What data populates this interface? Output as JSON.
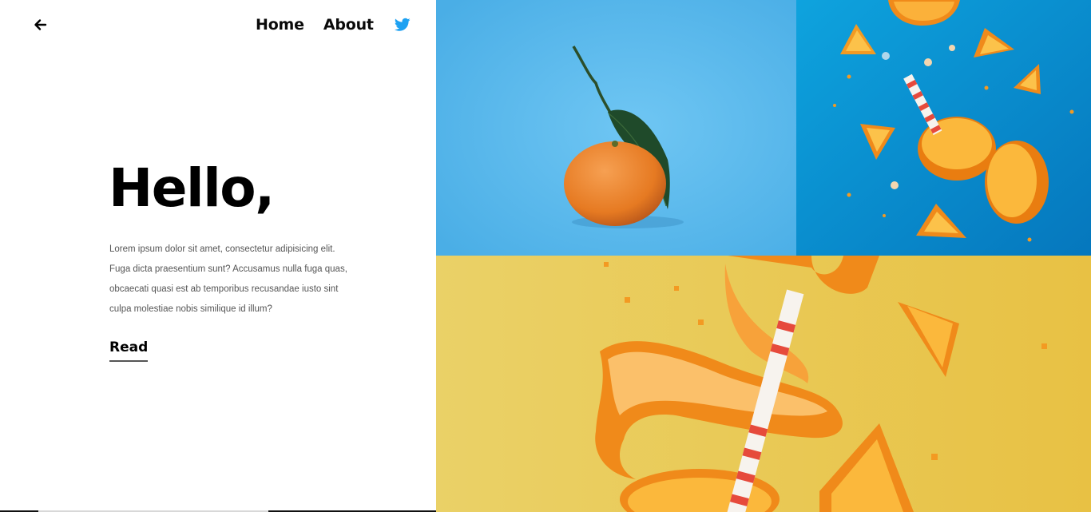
{
  "nav": {
    "back_icon": "arrow-left-icon",
    "links": [
      {
        "label": "Home"
      },
      {
        "label": "About"
      }
    ],
    "social_icon": "twitter-icon",
    "social_color": "#1da1f2"
  },
  "hero": {
    "title": "Hello,",
    "body": "Lorem ipsum dolor sit amet, consectetur adipisicing elit. Fuga dicta praesentium sunt? Accusamus nulla fuga quas, obcaecati quasi est ab temporibus recusandae iusto sint culpa molestiae nobis similique id illum?",
    "cta_label": "Read"
  },
  "gallery": {
    "colors": {
      "tile1_bg": "#5bbbec",
      "tile2_bg": "#0a8fd0",
      "tile3_bg": "#ecc94f",
      "orange": "#f5891f"
    }
  }
}
